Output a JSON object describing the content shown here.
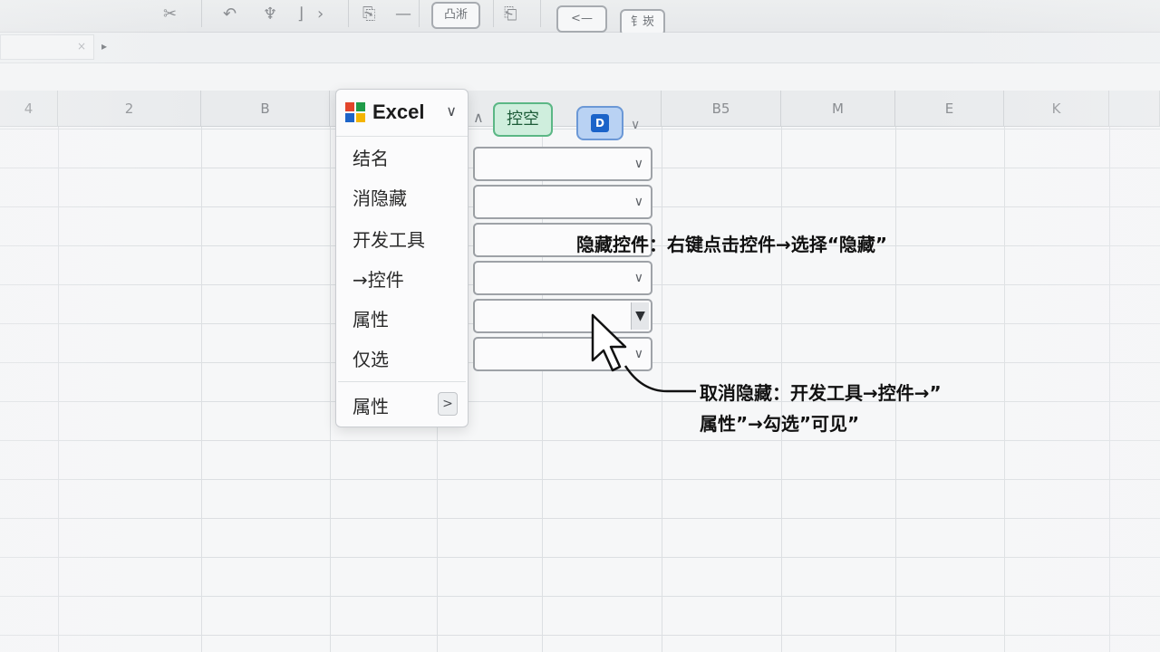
{
  "toolbar": {
    "btn_paste": "凸淅",
    "btn_back": "<—",
    "btn_last": "钅崁"
  },
  "columns": [
    {
      "label": "4"
    },
    {
      "label": "2"
    },
    {
      "label": "B"
    },
    {
      "label": "B5"
    },
    {
      "label": "M"
    },
    {
      "label": "E"
    },
    {
      "label": "K"
    }
  ],
  "menu": {
    "title": "Excel",
    "items": [
      "结名",
      "消隐藏",
      "开发工具",
      "→控件",
      "属性",
      "仅选"
    ],
    "footer_item": "属性"
  },
  "controls": {
    "kongkong_label": "控空",
    "d_label": "D"
  },
  "annotations": {
    "hide_tip": "隐藏控件：右键点击控件→选择“隐藏”",
    "unhide_tip_line1": "取消隐藏：开发工具→控件→”",
    "unhide_tip_line2": "属性”→勾选”可见”"
  },
  "colors": {
    "accent_green": "#5bb785",
    "accent_blue": "#1a63c9",
    "excel_red": "#e2452b",
    "excel_green": "#1f9b48",
    "excel_blue": "#1d64c8",
    "excel_yellow": "#f4b400"
  }
}
